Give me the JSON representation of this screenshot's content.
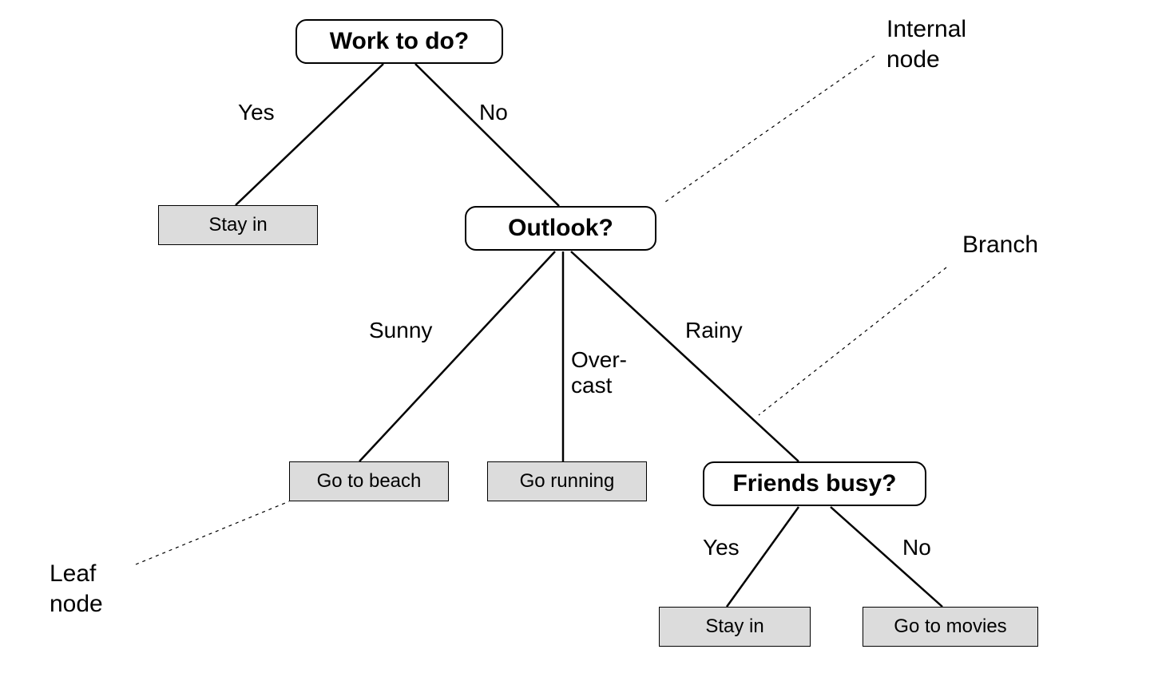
{
  "nodes": {
    "root": {
      "label": "Work to do?"
    },
    "outlook": {
      "label": "Outlook?"
    },
    "friends": {
      "label": "Friends busy?"
    },
    "stayin1": {
      "label": "Stay in"
    },
    "beach": {
      "label": "Go to beach"
    },
    "running": {
      "label": "Go running"
    },
    "stayin2": {
      "label": "Stay in"
    },
    "movies": {
      "label": "Go to movies"
    }
  },
  "edges": {
    "root_yes": "Yes",
    "root_no": "No",
    "outlook_sunny": "Sunny",
    "outlook_over": "Over-\ncast",
    "outlook_rainy": "Rainy",
    "friends_yes": "Yes",
    "friends_no": "No"
  },
  "annotations": {
    "internal_node": "Internal\nnode",
    "branch": "Branch",
    "leaf_node": "Leaf\nnode"
  }
}
